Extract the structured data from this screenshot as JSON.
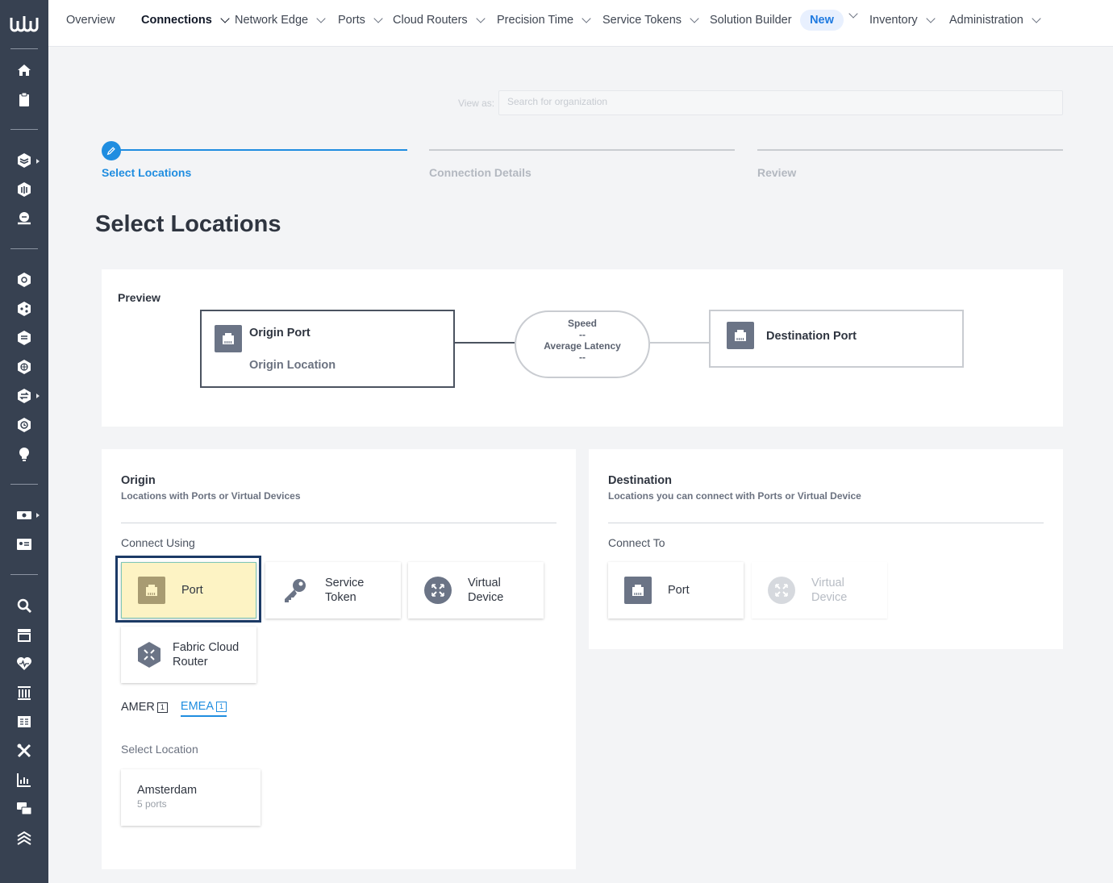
{
  "nav": {
    "items": [
      {
        "label": "Overview",
        "dropdown": false
      },
      {
        "label": "Connections",
        "dropdown": true,
        "active": true
      },
      {
        "label": "Network Edge",
        "dropdown": true
      },
      {
        "label": "Ports",
        "dropdown": true
      },
      {
        "label": "Cloud Routers",
        "dropdown": true
      },
      {
        "label": "Precision Time",
        "dropdown": true
      },
      {
        "label": "Service Tokens",
        "dropdown": true
      },
      {
        "label": "Solution Builder",
        "dropdown": false
      },
      {
        "label": "Inventory",
        "dropdown": true
      },
      {
        "label": "Administration",
        "dropdown": true
      }
    ],
    "new_badge": "New"
  },
  "view_as": {
    "label": "View as:",
    "placeholder": "Search for organization"
  },
  "stepper": {
    "steps": [
      "Select Locations",
      "Connection Details",
      "Review"
    ],
    "active_index": 0
  },
  "page_title": "Select Locations",
  "preview": {
    "title": "Preview",
    "origin": {
      "title": "Origin Port",
      "subtitle": "Origin Location"
    },
    "speed_label": "Speed",
    "speed_value": "--",
    "latency_label": "Average Latency",
    "latency_value": "--",
    "destination": {
      "title": "Destination Port"
    }
  },
  "origin": {
    "title": "Origin",
    "subtitle": "Locations with Ports or Virtual Devices",
    "connect_label": "Connect Using",
    "options": [
      {
        "label": "Port",
        "icon": "port-icon",
        "selected": true
      },
      {
        "label": "Service\nToken",
        "icon": "key-icon"
      },
      {
        "label": "Virtual\nDevice",
        "icon": "virtual-device-icon"
      },
      {
        "label": "Fabric Cloud\nRouter",
        "icon": "cloud-router-icon"
      }
    ],
    "regions": [
      {
        "label": "AMER",
        "count": "1",
        "active": false
      },
      {
        "label": "EMEA",
        "count": "1",
        "active": true
      }
    ],
    "location_label": "Select Location",
    "locations": [
      {
        "name": "Amsterdam",
        "ports": "5 ports"
      }
    ]
  },
  "destination": {
    "title": "Destination",
    "subtitle": "Locations you can connect with Ports or Virtual Device",
    "connect_label": "Connect To",
    "options": [
      {
        "label": "Port",
        "icon": "port-icon",
        "disabled": false
      },
      {
        "label": "Virtual\nDevice",
        "icon": "virtual-device-icon",
        "disabled": true
      }
    ]
  },
  "colors": {
    "rail": "#374151",
    "accent": "#1f8de0",
    "selected_tile": "#fdf3c4",
    "selected_outline": "#1c3a66",
    "icon_bg": "#6b7486"
  }
}
